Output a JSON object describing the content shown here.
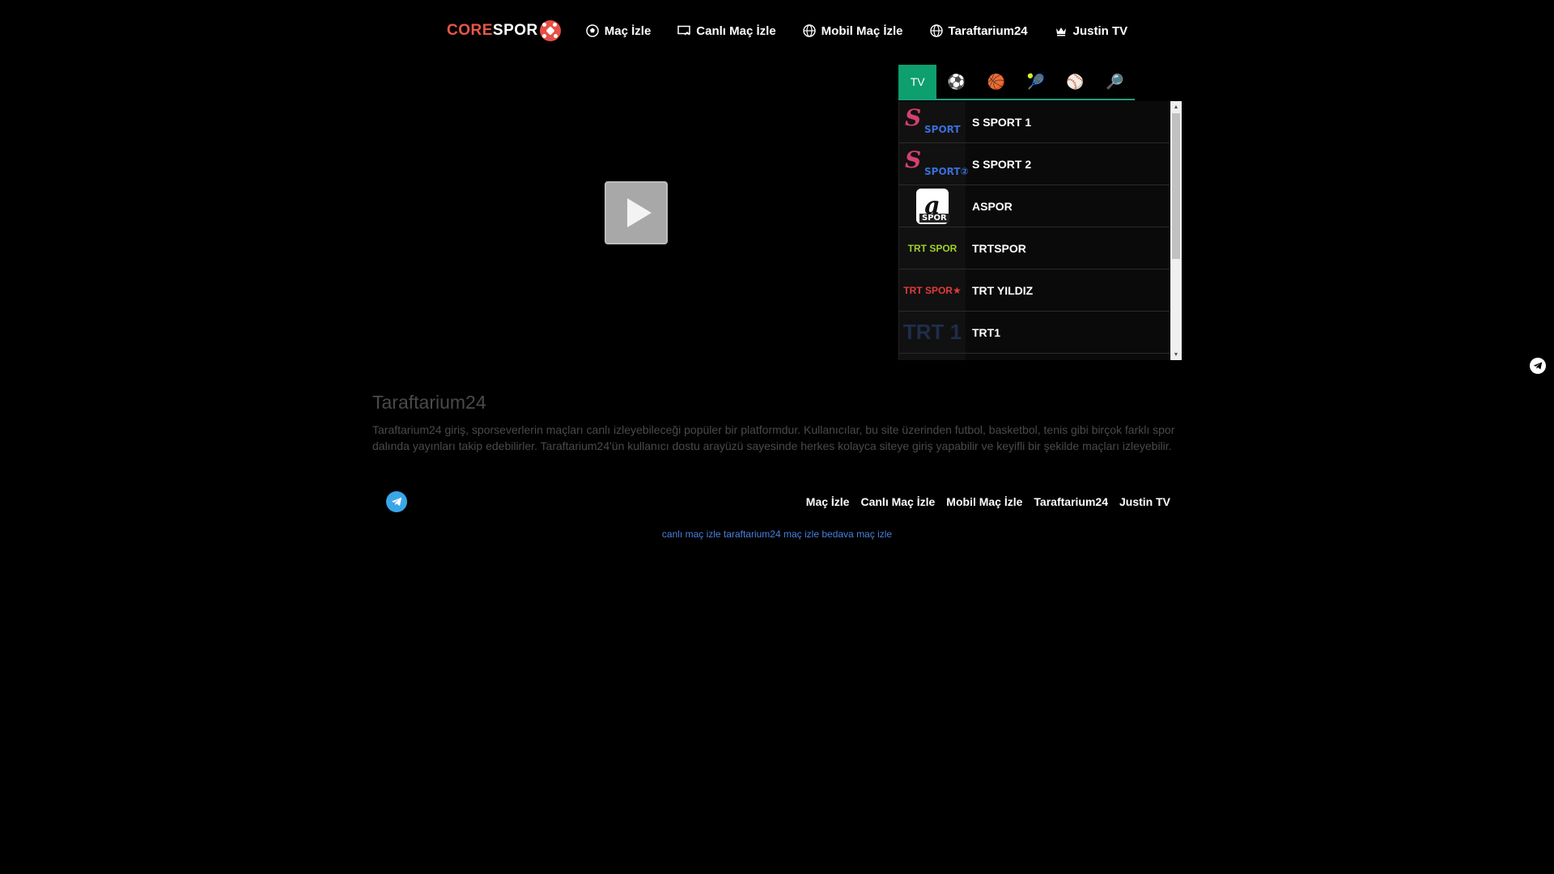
{
  "logo": {
    "core": "CORE",
    "spor": "SPOR"
  },
  "nav": [
    {
      "label": "Maç İzle",
      "icon": "soccer-ball-icon"
    },
    {
      "label": "Canlı Maç İzle",
      "icon": "screen-cast-icon"
    },
    {
      "label": "Mobil Maç İzle",
      "icon": "globe-icon"
    },
    {
      "label": "Taraftarium24",
      "icon": "globe-icon"
    },
    {
      "label": "Justin TV",
      "icon": "crown-icon"
    }
  ],
  "tabs": [
    {
      "label": "TV",
      "icon": "tv-icon",
      "active": true
    },
    {
      "label": "⚽",
      "icon": "football-icon"
    },
    {
      "label": "🏀",
      "icon": "basketball-icon"
    },
    {
      "label": "🎾",
      "icon": "tennis-icon"
    },
    {
      "label": "⚾",
      "icon": "baseball-icon"
    },
    {
      "label": "🔎",
      "icon": "search-icon"
    }
  ],
  "channels": [
    {
      "name": "S SPORT 1",
      "logo_text": "SPORT"
    },
    {
      "name": "S SPORT 2",
      "logo_text": "SPORT②"
    },
    {
      "name": "ASPOR",
      "logo_text": "SPOR"
    },
    {
      "name": "TRTSPOR",
      "logo_text": "TRT SPOR"
    },
    {
      "name": "TRT YILDIZ",
      "logo_text": "TRT SPOR★"
    },
    {
      "name": "TRT1",
      "logo_text": "TRT 1"
    },
    {
      "name": "",
      "logo_text": ""
    }
  ],
  "content": {
    "title": "Taraftarium24",
    "body": "Taraftarium24 giriş, sporseverlerin maçları canlı izleyebileceği popüler bir platformdur. Kullanıcılar, bu site üzerinden futbol, basketbol, tenis gibi birçok farklı spor dalında yayınları takip edebilirler. Taraftarium24'ün kullanıcı dostu arayüzü sayesinde herkes kolayca siteye giriş yapabilir ve keyifli bir şekilde maçları izleyebilir."
  },
  "footer": {
    "links": [
      "Maç İzle",
      "Canlı Maç İzle",
      "Mobil Maç İzle",
      "Taraftarium24",
      "Justin TV"
    ],
    "tags": [
      "canlı maç izle",
      "taraftarium24",
      "maç izle",
      "bedava maç izle"
    ]
  },
  "colors": {
    "accent": "#0e9f6e",
    "logo_red": "#e8574a",
    "link_blue": "#4a80e0",
    "telegram": "#3aa6e8"
  }
}
